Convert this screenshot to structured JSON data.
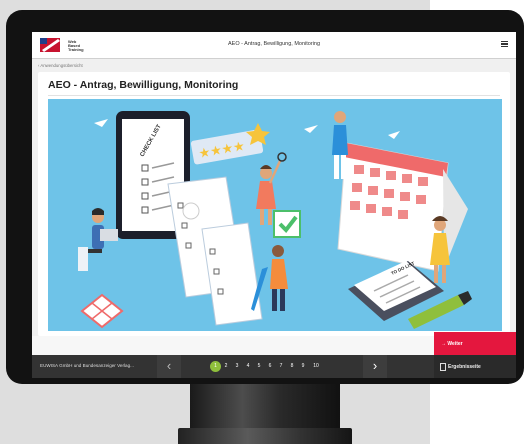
{
  "header": {
    "logo_text": "Web\nBased\nTraining",
    "title": "AEO - Antrag, Bewilligung, Monitoring"
  },
  "breadcrumb": "‹  Anwendungsübersicht",
  "main": {
    "heading": "AEO - Antrag, Bewilligung, Monitoring",
    "illustration_texts": {
      "checklist": "CHECK LIST",
      "todo": "TO DO LIST"
    }
  },
  "footer": {
    "company": "EUWISA GmbH und Bundesanzeiger Verlag...",
    "prev_icon": "chevron-left-icon",
    "next_icon": "chevron-right-icon",
    "pages": [
      "1",
      "2",
      "3",
      "4",
      "5",
      "6",
      "7",
      "8",
      "9",
      "10"
    ],
    "active_page": "1",
    "next_button": "→ Weiter",
    "results_button": "Ergebnisseite"
  },
  "colors": {
    "accent": "#e4173e",
    "active_page": "#8fbf3c",
    "footer_bg": "#333333",
    "illustration_bg": "#6ec3e8"
  }
}
